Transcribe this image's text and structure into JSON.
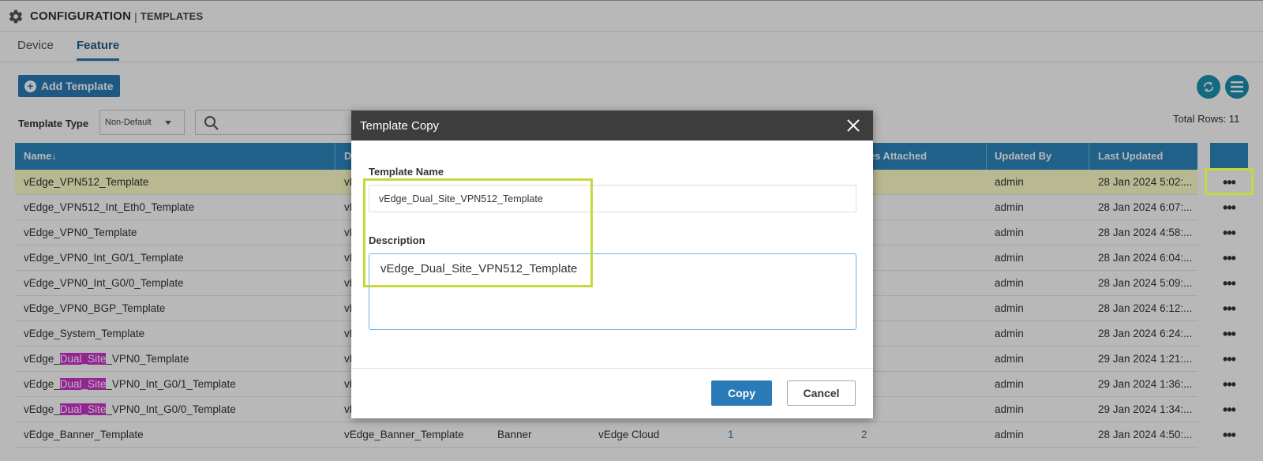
{
  "header": {
    "title": "CONFIGURATION",
    "separator": "|",
    "subtitle": "TEMPLATES"
  },
  "tabs": [
    {
      "label": "Device"
    },
    {
      "label": "Feature"
    }
  ],
  "toolbar": {
    "add_template_label": "Add Template",
    "template_type_label": "Template Type",
    "template_type_value": "Non-Default",
    "total_rows_label": "Total Rows: 11"
  },
  "table": {
    "headers": [
      "Name↓",
      "D",
      "ices Attached",
      "Updated By",
      "Last Updated"
    ],
    "rows": [
      {
        "name": "vEdge_VPN512_Template",
        "desc": "vE",
        "updated_by": "admin",
        "last_updated": "28 Jan 2024 5:02:..."
      },
      {
        "name": "vEdge_VPN512_Int_Eth0_Template",
        "desc": "vE",
        "updated_by": "admin",
        "last_updated": "28 Jan 2024 6:07:..."
      },
      {
        "name": "vEdge_VPN0_Template",
        "desc": "vE",
        "updated_by": "admin",
        "last_updated": "28 Jan 2024 4:58:..."
      },
      {
        "name": "vEdge_VPN0_Int_G0/1_Template",
        "desc": "vE",
        "updated_by": "admin",
        "last_updated": "28 Jan 2024 6:04:..."
      },
      {
        "name": "vEdge_VPN0_Int_G0/0_Template",
        "desc": "vE",
        "updated_by": "admin",
        "last_updated": "28 Jan 2024 5:09:..."
      },
      {
        "name": "vEdge_VPN0_BGP_Template",
        "desc": "vE",
        "updated_by": "admin",
        "last_updated": "28 Jan 2024 6:12:..."
      },
      {
        "name": "vEdge_System_Template",
        "desc": "vE",
        "updated_by": "admin",
        "last_updated": "28 Jan 2024 6:24:..."
      },
      {
        "name_pre": "vEdge_",
        "name_hl": "Dual_Site",
        "name_post": "_VPN0_Template",
        "desc": "vE",
        "updated_by": "admin",
        "last_updated": "29 Jan 2024 1:21:..."
      },
      {
        "name_pre": "vEdge_",
        "name_hl": "Dual_Site",
        "name_post": "_VPN0_Int_G0/1_Template",
        "desc": "vE",
        "updated_by": "admin",
        "last_updated": "29 Jan 2024 1:36:..."
      },
      {
        "name_pre": "vEdge_",
        "name_hl": "Dual_Site",
        "name_post": "_VPN0_Int_G0/0_Template",
        "desc": "vE",
        "updated_by": "admin",
        "last_updated": "29 Jan 2024 1:34:..."
      },
      {
        "name": "vEdge_Banner_Template",
        "desc": "vEdge_Banner_Template",
        "type": "Banner",
        "device_type": "vEdge Cloud",
        "devices_col": "1",
        "attached": "2",
        "updated_by": "admin",
        "last_updated": "28 Jan 2024 4:50:..."
      }
    ],
    "row_action_label": "•••"
  },
  "modal": {
    "title": "Template Copy",
    "name_label": "Template Name",
    "name_value": "vEdge_Dual_Site_VPN512_Template",
    "description_label": "Description",
    "description_value": "vEdge_Dual_Site_VPN512_Template",
    "copy_label": "Copy",
    "cancel_label": "Cancel"
  },
  "colors": {
    "accent": "#2a7ab8",
    "header_row": "#2d87c0",
    "highlight": "#cc33cc",
    "callout": "#c8d640",
    "selected_row": "#ffffcc"
  },
  "icons": [
    "gear-icon",
    "plus-circle-icon",
    "refresh-icon",
    "menu-icon",
    "search-icon",
    "caret-down-icon",
    "close-icon",
    "more-icon"
  ]
}
